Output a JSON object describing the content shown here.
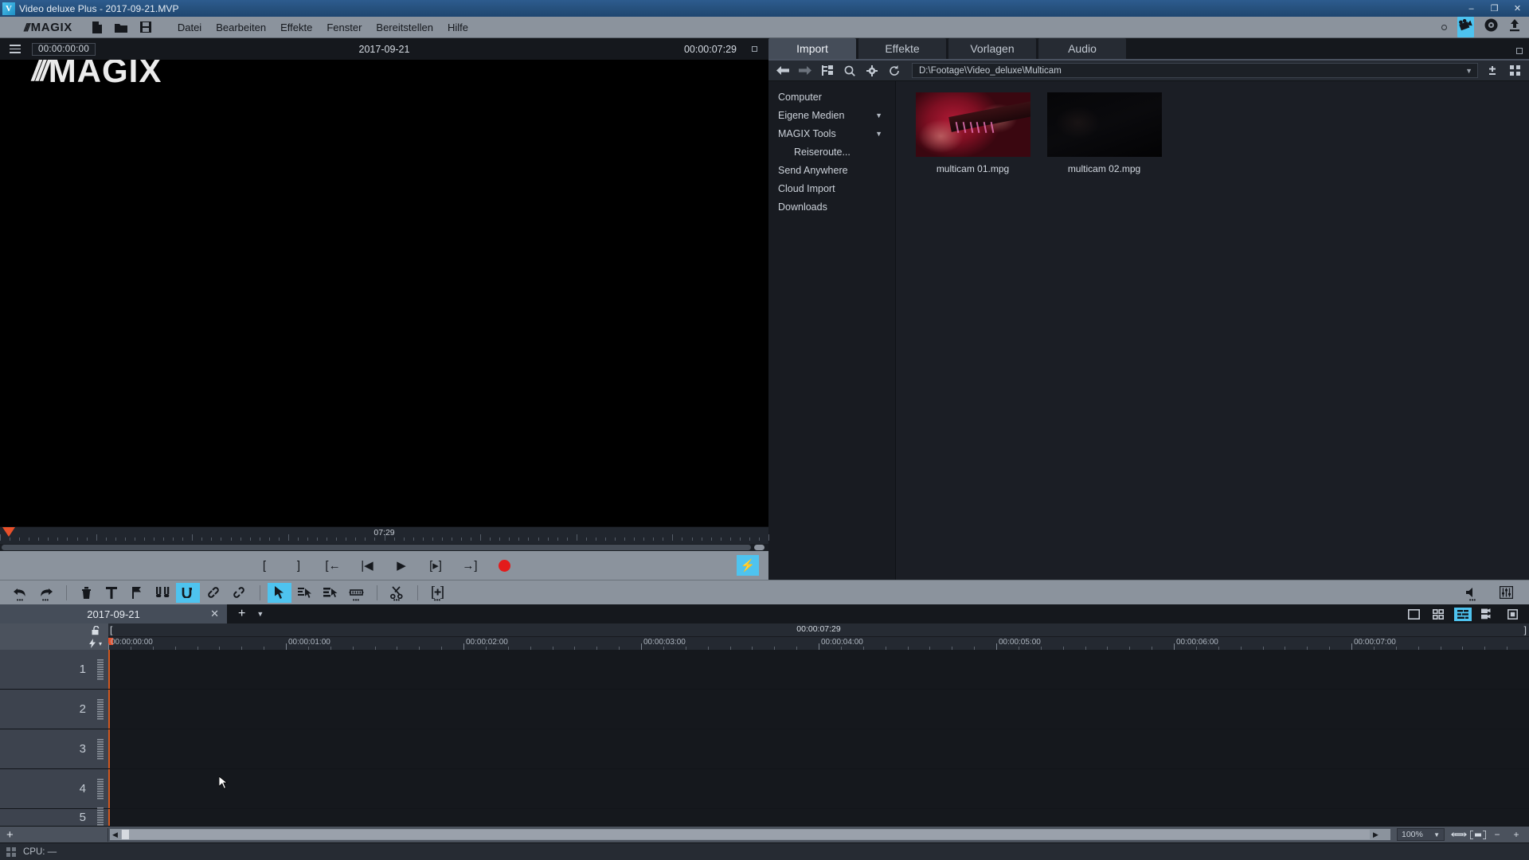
{
  "titlebar": {
    "icon": "magix-v-icon",
    "title": "Video deluxe Plus - 2017-09-21.MVP",
    "minimize": "–",
    "maximize": "❐",
    "close": "✕"
  },
  "menubar": {
    "logo_slashes": "///",
    "logo_text": "MAGIX",
    "icons": [
      {
        "name": "new-project-icon",
        "glyph": "὜B"
      },
      {
        "name": "open-project-icon",
        "glyph": "▰"
      },
      {
        "name": "save-project-icon",
        "glyph": "ὋE"
      }
    ],
    "items": [
      {
        "label": "Datei"
      },
      {
        "label": "Bearbeiten"
      },
      {
        "label": "Effekte"
      },
      {
        "label": "Fenster"
      },
      {
        "label": "Bereitstellen"
      },
      {
        "label": "Hilfe"
      }
    ],
    "right_icons": [
      {
        "name": "record-dot-icon",
        "glyph": ""
      },
      {
        "name": "film-capture-icon",
        "glyph": "ἺC"
      },
      {
        "name": "burn-disc-icon",
        "glyph": "◉"
      },
      {
        "name": "export-upload-icon",
        "glyph": "⬆"
      }
    ]
  },
  "preview": {
    "menu_icon": "hamburger-icon",
    "current_timecode": "00:00:00:00",
    "project_title": "2017-09-21",
    "duration": "00:00:07:29",
    "maximize_icon": "maximize-preview-icon",
    "watermark_slashes": "///",
    "watermark_text": "MAGIX",
    "scrub_position_label": "07:29",
    "transport": [
      {
        "name": "set-in-point-button",
        "label": "["
      },
      {
        "name": "set-out-point-button",
        "label": "]"
      },
      {
        "name": "jump-to-start-button",
        "label": "[←"
      },
      {
        "name": "previous-frame-button",
        "label": "|◀"
      },
      {
        "name": "play-button",
        "label": "▶"
      },
      {
        "name": "play-range-button",
        "label": "[▸]"
      },
      {
        "name": "jump-to-end-button",
        "label": "→]"
      },
      {
        "name": "record-button",
        "label": ""
      }
    ],
    "turbo_label": "⚡"
  },
  "mediapool": {
    "tabs": [
      {
        "label": "Import",
        "active": true
      },
      {
        "label": "Effekte",
        "active": false
      },
      {
        "label": "Vorlagen",
        "active": false
      },
      {
        "label": "Audio",
        "active": false
      }
    ],
    "toolbar_icons": [
      {
        "name": "nav-back-icon",
        "glyph": "←"
      },
      {
        "name": "nav-forward-icon",
        "glyph": "→"
      },
      {
        "name": "folder-tree-icon",
        "glyph": "☰"
      },
      {
        "name": "search-icon",
        "glyph": "⚲"
      },
      {
        "name": "settings-gear-icon",
        "glyph": "⚙"
      },
      {
        "name": "refresh-icon",
        "glyph": "↻"
      }
    ],
    "path": "D:\\Footage\\Video_deluxe\\Multicam",
    "path_caret": "▼",
    "right_icons": [
      {
        "name": "size-adjust-icon",
        "glyph": "±"
      },
      {
        "name": "view-grid-icon",
        "glyph": "▦"
      }
    ],
    "tree": [
      {
        "label": "Computer",
        "expandable": false,
        "indent": false
      },
      {
        "label": "Eigene Medien",
        "expandable": true,
        "indent": false
      },
      {
        "label": "MAGIX Tools",
        "expandable": true,
        "indent": false
      },
      {
        "label": "Reiseroute...",
        "expandable": false,
        "indent": true
      },
      {
        "label": "Send Anywhere",
        "expandable": false,
        "indent": false
      },
      {
        "label": "Cloud Import",
        "expandable": false,
        "indent": false
      },
      {
        "label": "Downloads",
        "expandable": false,
        "indent": false
      }
    ],
    "expand_caret": "▼",
    "files": [
      {
        "name": "multicam 01.mpg",
        "style": "guitar"
      },
      {
        "name": "multicam 02.mpg",
        "style": "dark"
      }
    ]
  },
  "edit_toolbar": {
    "groups": [
      [
        {
          "name": "undo-button",
          "glyph": "↶",
          "more": true,
          "active": false
        },
        {
          "name": "redo-button",
          "glyph": "↷",
          "more": true,
          "active": false
        }
      ],
      [
        {
          "name": "delete-object-button",
          "glyph": "Ὕ1",
          "more": false,
          "active": false
        },
        {
          "name": "insert-title-button",
          "glyph": "T",
          "more": false,
          "active": false
        },
        {
          "name": "set-marker-button",
          "glyph": "⚑",
          "more": false,
          "active": false
        },
        {
          "name": "split-object-button",
          "glyph": "⫯",
          "more": false,
          "active": false
        },
        {
          "name": "loop-mode-button",
          "glyph": "↺",
          "more": false,
          "active": true
        },
        {
          "name": "group-objects-button",
          "glyph": "ὑ7",
          "more": false,
          "active": false
        },
        {
          "name": "ungroup-objects-button",
          "glyph": "⚭",
          "more": false,
          "active": false
        }
      ],
      [
        {
          "name": "mouse-mode-arrow-button",
          "glyph": "➤",
          "more": false,
          "active": true
        },
        {
          "name": "mouse-mode-single-object-button",
          "glyph": "⫸",
          "more": false,
          "active": false
        },
        {
          "name": "mouse-mode-all-tracks-button",
          "glyph": "⫹",
          "more": false,
          "active": false
        },
        {
          "name": "mouse-mode-stretch-button",
          "glyph": "↔",
          "more": true,
          "active": false
        }
      ],
      [
        {
          "name": "cut-scissors-button",
          "glyph": "✂",
          "more": true,
          "active": false
        }
      ],
      [
        {
          "name": "add-track-button",
          "glyph": "⊞",
          "more": true,
          "active": false
        }
      ]
    ],
    "right": [
      {
        "name": "audio-volume-button",
        "glyph": "ὐA",
        "more": true
      },
      {
        "name": "mixer-button",
        "glyph": "☳",
        "more": false
      }
    ]
  },
  "timeline": {
    "tab": {
      "label": "2017-09-21",
      "close": "✕"
    },
    "new_tab_plus": "+",
    "tab_caret": "▼",
    "view_modes": [
      {
        "name": "storyboard-view-button",
        "glyph": "□",
        "active": false
      },
      {
        "name": "scene-overview-view-button",
        "glyph": "▦",
        "active": false
      },
      {
        "name": "timeline-view-button",
        "glyph": "☰",
        "active": true
      },
      {
        "name": "multicam-view-button",
        "glyph": "Ἲ5",
        "active": false
      },
      {
        "name": "maximize-timeline-button",
        "glyph": "▣",
        "active": false
      }
    ],
    "ruler_head": {
      "lock_icon": "ὑ3",
      "bolt_icon": "⚡",
      "bolt_caret": "▾"
    },
    "range_bracket_left": "[",
    "range_bracket_right": "]",
    "project_length": "00:00:07:29",
    "ruler_labels": [
      {
        "time": "00:00:00:00",
        "pos_pct": 0
      },
      {
        "time": "00:00:01:00",
        "pos_pct": 12.5
      },
      {
        "time": "00:00:02:00",
        "pos_pct": 25
      },
      {
        "time": "00:00:03:00",
        "pos_pct": 37.5
      },
      {
        "time": "00:00:04:00",
        "pos_pct": 50
      },
      {
        "time": "00:00:05:00",
        "pos_pct": 62.5
      },
      {
        "time": "00:00:06:00",
        "pos_pct": 75
      },
      {
        "time": "00:00:07:00",
        "pos_pct": 87.5
      }
    ],
    "tracks": [
      {
        "number": "1"
      },
      {
        "number": "2"
      },
      {
        "number": "3"
      },
      {
        "number": "4"
      },
      {
        "number": "5"
      }
    ],
    "add_track_plus": "+",
    "scroll_left_arrow": "◀",
    "scroll_right_arrow": "▶",
    "zoom_level": "100%",
    "zoom_caret": "▼",
    "zoom_buttons": [
      {
        "name": "zoom-fit-width-button",
        "glyph": "⇔"
      },
      {
        "name": "zoom-fit-selection-button",
        "glyph": "⧉"
      },
      {
        "name": "zoom-out-button",
        "glyph": "−"
      },
      {
        "name": "zoom-in-button",
        "glyph": "+"
      }
    ]
  },
  "statusbar": {
    "grid_icon": "app-grid-icon",
    "cpu_text": "CPU: —"
  },
  "colors": {
    "accent": "#4ec3ef",
    "playhead": "#d2581f",
    "record": "#e31b1b",
    "chrome": "#8b939d",
    "panel_dark": "#181b21",
    "titlebar": "#27527f"
  }
}
